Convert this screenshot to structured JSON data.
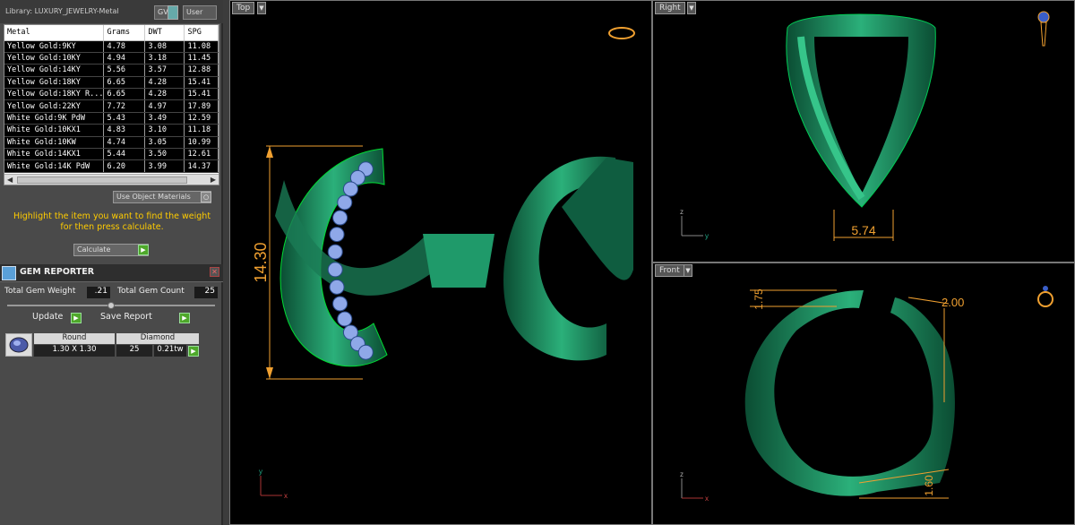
{
  "library": {
    "title": "Library: LUXURY_JEWELRY-Metal",
    "gv_label": "GV",
    "user_label": "User"
  },
  "metal_table": {
    "headers": [
      "Metal",
      "Grams",
      "DWT",
      "SPG"
    ],
    "rows": [
      [
        "Yellow Gold:9KY",
        "4.78",
        "3.08",
        "11.08"
      ],
      [
        "Yellow Gold:10KY",
        "4.94",
        "3.18",
        "11.45"
      ],
      [
        "Yellow Gold:14KY",
        "5.56",
        "3.57",
        "12.88"
      ],
      [
        "Yellow Gold:18KY",
        "6.65",
        "4.28",
        "15.41"
      ],
      [
        "Yellow Gold:18KY R...",
        "6.65",
        "4.28",
        "15.41"
      ],
      [
        "Yellow Gold:22KY",
        "7.72",
        "4.97",
        "17.89"
      ],
      [
        "White Gold:9K PdW",
        "5.43",
        "3.49",
        "12.59"
      ],
      [
        "White Gold:10KX1",
        "4.83",
        "3.10",
        "11.18"
      ],
      [
        "White Gold:10KW",
        "4.74",
        "3.05",
        "10.99"
      ],
      [
        "White Gold:14KX1",
        "5.44",
        "3.50",
        "12.61"
      ],
      [
        "White Gold:14K PdW",
        "6.20",
        "3.99",
        "14.37"
      ]
    ]
  },
  "use_object_materials": "Use Object Materials",
  "hint_line1": "Highlight the item you want to find the weight",
  "hint_line2": "for then press calculate.",
  "calculate_label": "Calculate",
  "gem_reporter": {
    "title": "GEM REPORTER",
    "total_weight_label": "Total Gem Weight",
    "total_weight_value": ".21",
    "total_count_label": "Total Gem Count",
    "total_count_value": "25",
    "update_label": "Update",
    "save_report_label": "Save Report",
    "columns": [
      "Round",
      "Diamond"
    ],
    "row": {
      "size": "1.30 X 1.30",
      "count": "25",
      "weight": "0.21tw"
    }
  },
  "viewports": {
    "top": {
      "label": "Top",
      "dim": "14.30",
      "axis_y": "y",
      "axis_x": "x"
    },
    "right": {
      "label": "Right",
      "dim": "5.74",
      "axis_z": "z",
      "axis_y": "y"
    },
    "front": {
      "label": "Front",
      "dim1": "1.75",
      "dim2": "2.00",
      "dim3": "1.60",
      "axis_z": "z",
      "axis_x": "x"
    }
  },
  "colors": {
    "ring_green": "#1f8f63",
    "dimension_orange": "#f0a030",
    "gem_blue": "#8fa8e8",
    "hint_yellow": "#ffcc00"
  }
}
